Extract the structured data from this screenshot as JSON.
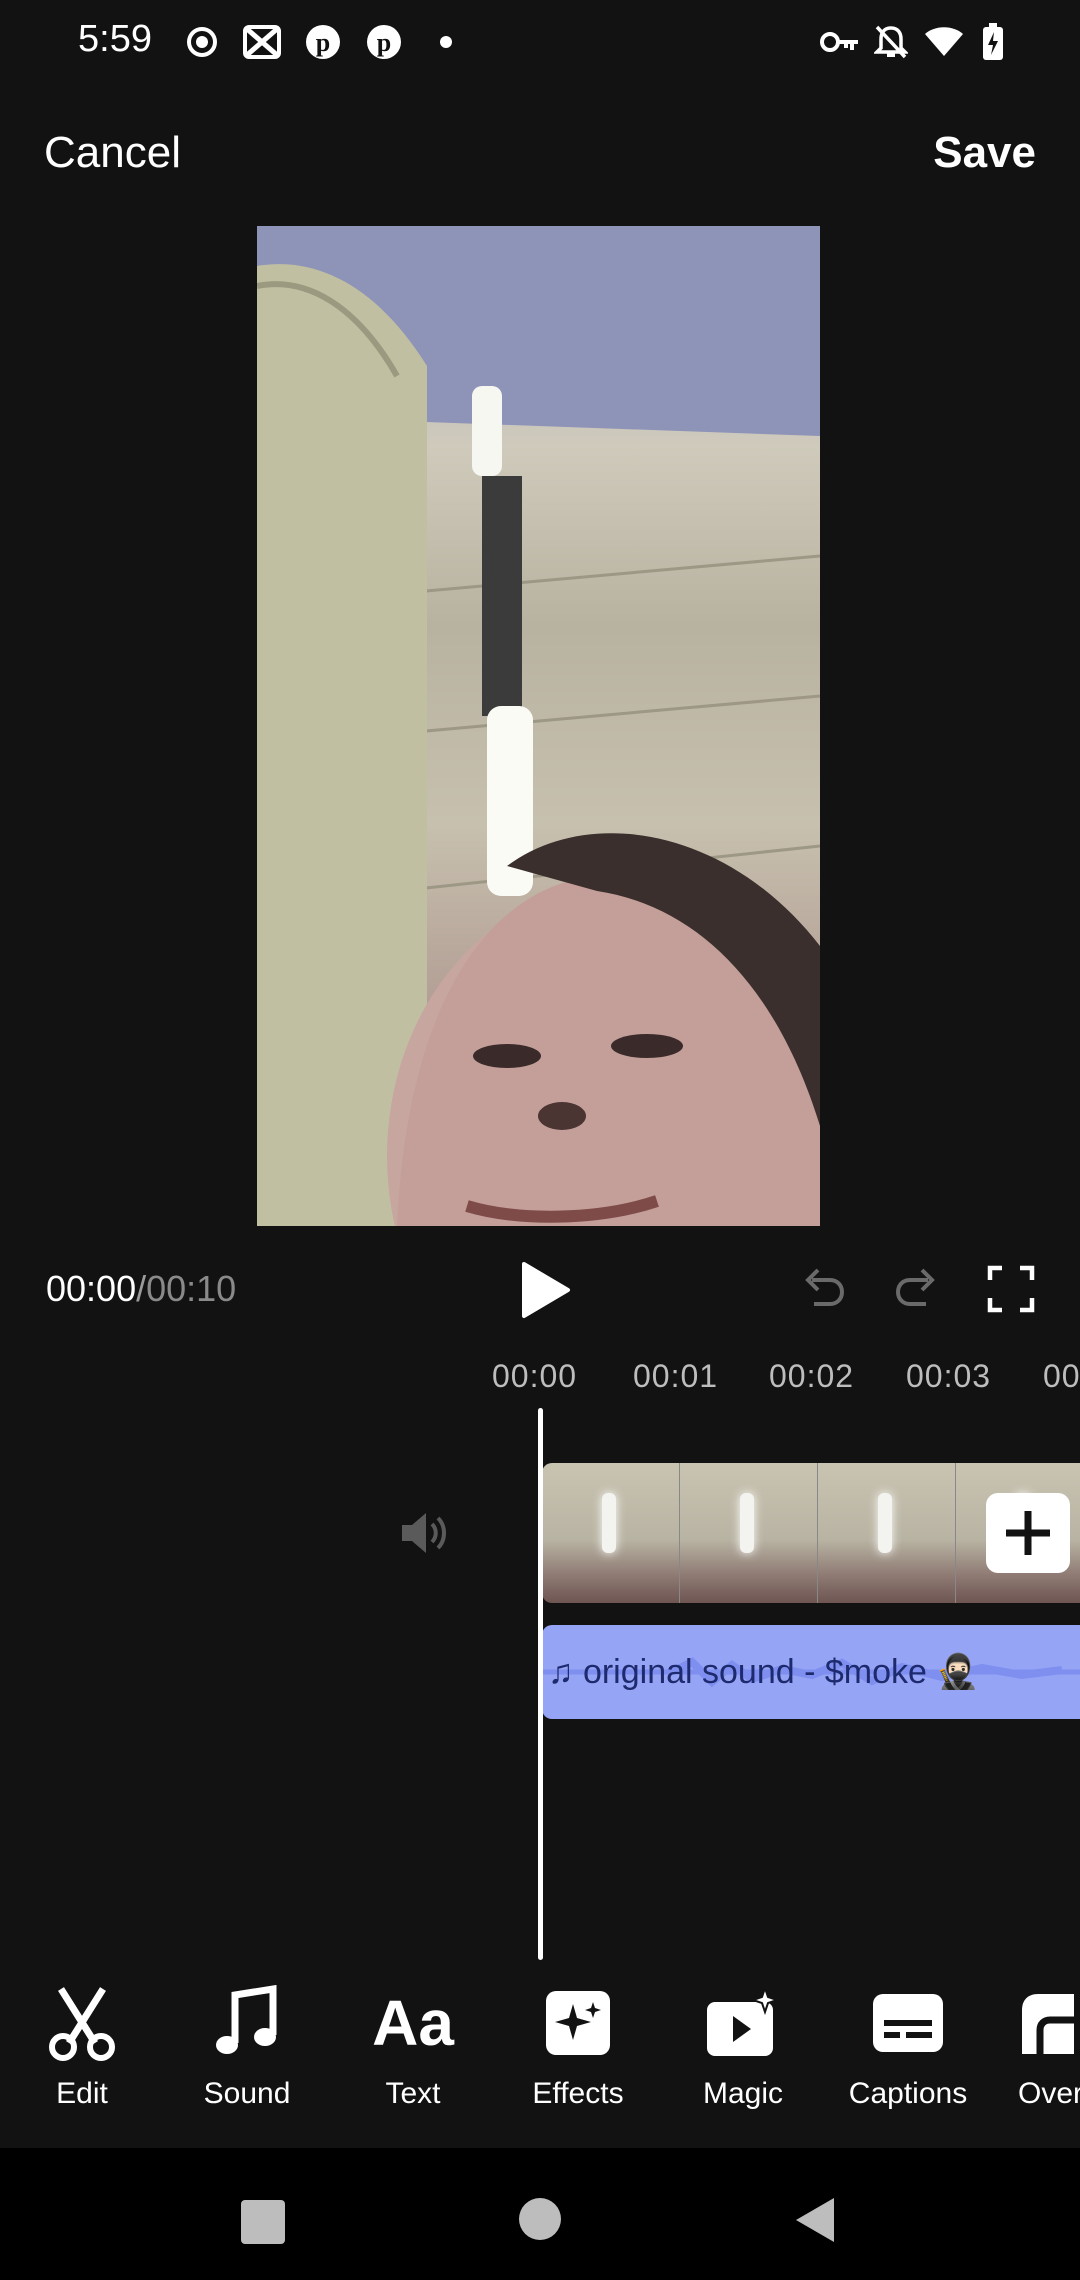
{
  "status_bar": {
    "time": "5:59",
    "left_icons": [
      "record-icon",
      "capcut-icon",
      "pinterest-icon",
      "pinterest-icon",
      "dot-icon"
    ],
    "right_icons": [
      "vpn-key-icon",
      "bell-off-icon",
      "wifi-icon",
      "battery-charging-icon"
    ]
  },
  "top_bar": {
    "cancel_label": "Cancel",
    "save_label": "Save"
  },
  "playback": {
    "current_time": "00:00",
    "separator": "/",
    "total_time": "00:10"
  },
  "ruler": {
    "ticks": [
      "00:00",
      "00:01",
      "00:02",
      "00:03",
      "00"
    ]
  },
  "timeline": {
    "audio_label": "♫ original sound - $moke 🥷🏻"
  },
  "toolbar": {
    "items": [
      {
        "label": "Edit",
        "icon": "scissors-icon"
      },
      {
        "label": "Sound",
        "icon": "music-note-icon"
      },
      {
        "label": "Text",
        "icon": "text-aa-icon"
      },
      {
        "label": "Effects",
        "icon": "sparkles-icon"
      },
      {
        "label": "Magic",
        "icon": "magic-play-icon"
      },
      {
        "label": "Captions",
        "icon": "captions-icon"
      },
      {
        "label": "Over",
        "icon": "overlay-icon"
      }
    ]
  },
  "colors": {
    "background": "#121212",
    "audio_track": "#96a4f5",
    "audio_text": "#1d2a6e"
  }
}
